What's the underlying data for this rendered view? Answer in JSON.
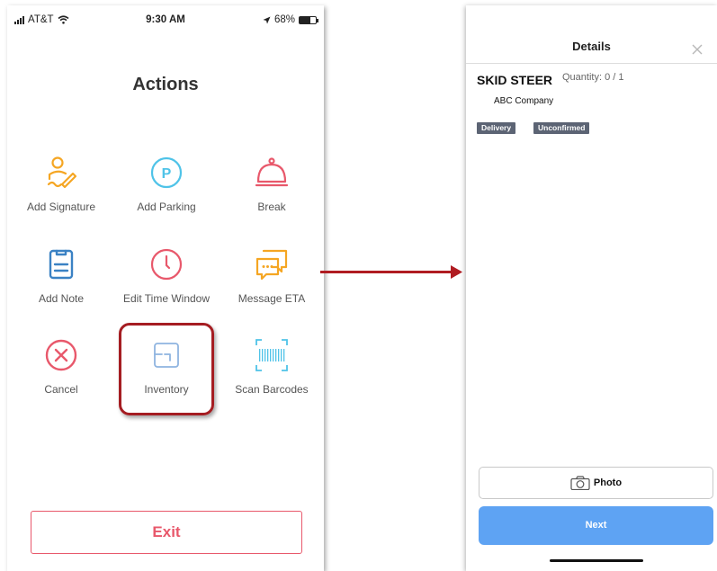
{
  "left_screen": {
    "status_bar": {
      "carrier": "AT&T",
      "time": "9:30 AM",
      "battery": "68%",
      "battery_level": 0.68
    },
    "title": "Actions",
    "actions": [
      {
        "label": "Add Signature",
        "icon": "signature-icon",
        "color": "#f5a623"
      },
      {
        "label": "Add Parking",
        "icon": "parking-icon",
        "color": "#4fc3e8"
      },
      {
        "label": "Break",
        "icon": "bell-icon",
        "color": "#e8586b"
      },
      {
        "label": "Add Note",
        "icon": "clipboard-icon",
        "color": "#3b82c4"
      },
      {
        "label": "Edit Time Window",
        "icon": "clock-icon",
        "color": "#e8586b"
      },
      {
        "label": "Message ETA",
        "icon": "chat-icon",
        "color": "#f5a623"
      },
      {
        "label": "Cancel",
        "icon": "cancel-icon",
        "color": "#e8586b"
      },
      {
        "label": "Inventory",
        "icon": "inventory-icon",
        "color": "#8fb4e0"
      },
      {
        "label": "Scan Barcodes",
        "icon": "barcode-icon",
        "color": "#4fc3e8"
      }
    ],
    "exit_label": "Exit",
    "highlight_color": "#a51d22"
  },
  "right_screen": {
    "title": "Details",
    "item": {
      "name": "SKID STEER",
      "quantity": "Quantity: 0 / 1",
      "company": "ABC Company",
      "badges": [
        "Delivery",
        "Unconfirmed"
      ]
    },
    "photo_label": "Photo",
    "next_label": "Next",
    "accent": "#5ea3f3"
  },
  "arrow_color": "#b01c22"
}
